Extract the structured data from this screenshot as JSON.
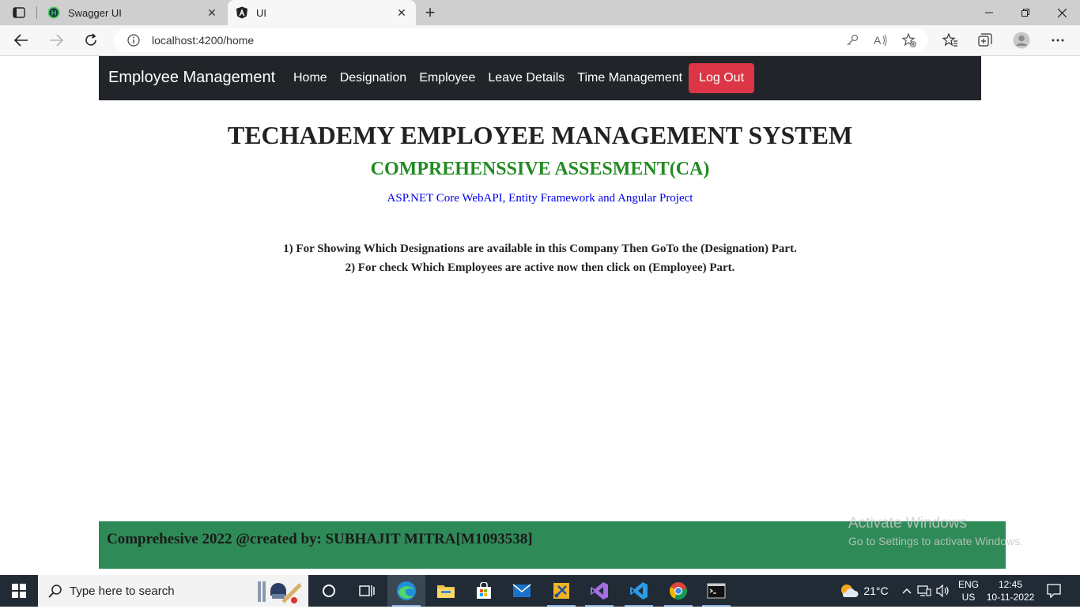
{
  "browser": {
    "tabs": [
      {
        "title": "Swagger UI",
        "favicon": "swagger-icon",
        "active": false
      },
      {
        "title": "UI",
        "favicon": "angular-icon",
        "active": true
      }
    ],
    "url": "localhost:4200/home"
  },
  "app": {
    "brand": "Employee Management",
    "nav": [
      "Home",
      "Designation",
      "Employee",
      "Leave Details",
      "Time Management"
    ],
    "logout_label": "Log Out",
    "colors": {
      "navbar": "#212529",
      "logout": "#dc3545",
      "subtitle": "#228b22",
      "link_blue": "#0000ee",
      "footer": "#2e8b57"
    }
  },
  "main": {
    "title": "TECHADEMY EMPLOYEE MANAGEMENT SYSTEM",
    "subtitle": "COMPREHENSSIVE ASSESMENT(CA)",
    "tech_line": "ASP.NET Core WebAPI, Entity Framework and Angular Project",
    "points": [
      "1) For Showing Which Designations are available in this Company Then GoTo the (Designation) Part.",
      "2) For check Which Employees are active now then click on (Employee) Part."
    ]
  },
  "footer": {
    "text": "Comprehesive 2022 @created by: SUBHAJIT MITRA[M1093538]"
  },
  "watermark": {
    "line1": "Activate Windows",
    "line2": "Go to Settings to activate Windows."
  },
  "taskbar": {
    "search_placeholder": "Type here to search",
    "weather": "21°C",
    "lang_top": "ENG",
    "lang_bottom": "US",
    "time": "12:45",
    "date": "10-11-2022"
  }
}
